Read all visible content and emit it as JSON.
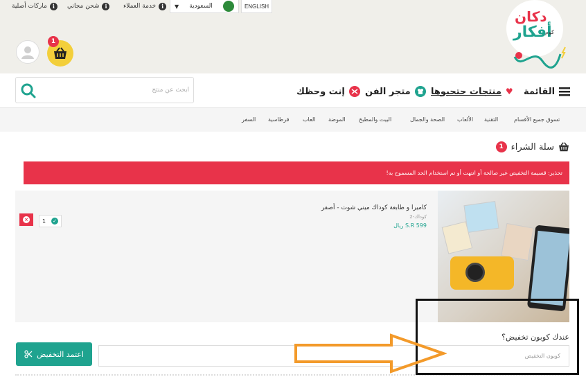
{
  "top_bar": {
    "language_button": "ENGLISH",
    "country": "السعودية",
    "links": [
      "خدمة العملاء",
      "شحن مجاني",
      "ماركات أصلية"
    ]
  },
  "logo": {
    "line1": "دكان",
    "line2": "أفكار",
    "suffix": "كوم"
  },
  "header": {
    "cart_count": "1"
  },
  "nav": {
    "menu_label": "القائمة",
    "favorites_label": "منتجات حتحبوها",
    "art_store_label": "متجر الفن",
    "luck_label": "إنت وحظك",
    "search_placeholder": "ابحث عن منتج"
  },
  "categories": [
    "تسوق جميع الأقسام",
    "التقنية",
    "الألعاب",
    "الصحة والجمال",
    "البيت والمطبخ",
    "الموضة",
    "العاب",
    "قرطاسية",
    "السفر"
  ],
  "cart": {
    "title": "سلة الشراء",
    "count": "1",
    "alert": "تحذير: قسيمة التخفيض غير صالحة أو انتهت أو تم استخدام الحد المسموح به!",
    "item": {
      "name": "كاميرا و طابعة كوداك ميني شوت - أصفر",
      "brand": "كوداك-2",
      "price": "599 S.R ريال",
      "quantity": "1"
    },
    "coupon_label": "عندك كوبون تخفيض؟",
    "coupon_placeholder": "كوبون التخفيض",
    "apply_button": "اعتمد التخفيض"
  },
  "colors": {
    "accent_teal": "#1fa38f",
    "accent_red": "#e8334a",
    "cart_yellow": "#f3cf3b",
    "annotation_arrow": "#f39a2a"
  }
}
